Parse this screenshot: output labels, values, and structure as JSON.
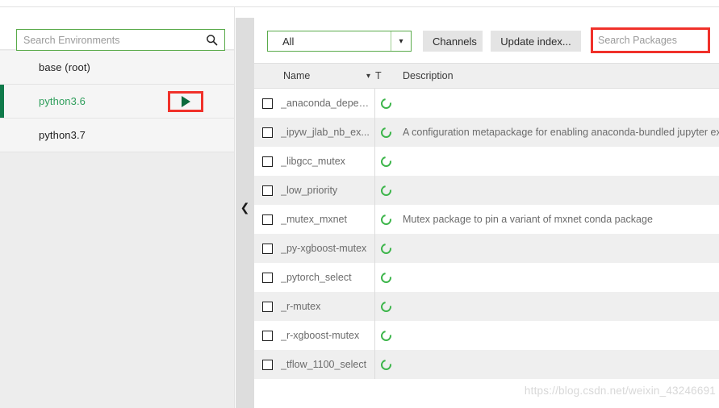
{
  "environments_panel": {
    "search": {
      "placeholder": "Search Environments",
      "value": "",
      "icon": "search-icon"
    },
    "items": [
      {
        "label": "base (root)",
        "selected": false,
        "has_run_button": false
      },
      {
        "label": "python3.6",
        "selected": true,
        "has_run_button": true
      },
      {
        "label": "python3.7",
        "selected": false,
        "has_run_button": false
      }
    ],
    "run_button": {
      "icon": "play-icon",
      "highlight_color": "#f0312a"
    },
    "selected_accent_color": "#0f7a4a"
  },
  "splitter": {
    "collapse_icon": "chevron-left-icon"
  },
  "packages_panel": {
    "toolbar": {
      "filter": {
        "value": "All",
        "arrow_icon": "chevron-down-icon",
        "border_color": "#5aab4b"
      },
      "channels_label": "Channels",
      "update_index_label": "Update index...",
      "search": {
        "placeholder": "Search Packages",
        "value": "",
        "icon": "search-icon",
        "highlight_color": "#f0312a"
      }
    },
    "table": {
      "columns": {
        "name": "Name",
        "type": "T",
        "description": "Description"
      },
      "sort_icon": "chevron-down-icon",
      "status_icon": "install-ring-icon",
      "status_color": "#3cb54a",
      "rows": [
        {
          "checked": false,
          "name": "_anaconda_depends",
          "description": ""
        },
        {
          "checked": false,
          "name": "_ipyw_jlab_nb_ex...",
          "description": "A configuration metapackage for enabling anaconda-bundled jupyter ex"
        },
        {
          "checked": false,
          "name": "_libgcc_mutex",
          "description": ""
        },
        {
          "checked": false,
          "name": "_low_priority",
          "description": ""
        },
        {
          "checked": false,
          "name": "_mutex_mxnet",
          "description": "Mutex package to pin a variant of mxnet conda package"
        },
        {
          "checked": false,
          "name": "_py-xgboost-mutex",
          "description": ""
        },
        {
          "checked": false,
          "name": "_pytorch_select",
          "description": ""
        },
        {
          "checked": false,
          "name": "_r-mutex",
          "description": ""
        },
        {
          "checked": false,
          "name": "_r-xgboost-mutex",
          "description": ""
        },
        {
          "checked": false,
          "name": "_tflow_1100_select",
          "description": ""
        }
      ]
    }
  },
  "watermark": {
    "text": "https://blog.csdn.net/weixin_43246691"
  }
}
